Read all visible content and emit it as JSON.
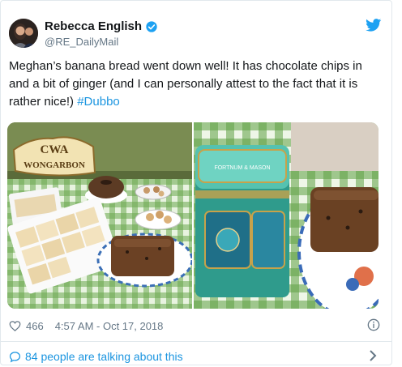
{
  "tweet": {
    "author": {
      "display_name": "Rebecca English",
      "handle": "@RE_DailyMail",
      "verified": true,
      "avatar_icon": "avatar-photo"
    },
    "text_main": "Meghan’s banana bread went down well! It has chocolate chips in and a bit of ginger (and I can personally attest to the fact that it is rather nice!) ",
    "hashtag": "#Dubbo",
    "photos": [
      {
        "sign_line1": "CWA",
        "sign_line2": "WONGARBON"
      },
      {
        "tin_brand": "FORTNUM & MASON"
      }
    ],
    "likes": "466",
    "timestamp": "4:57 AM - Oct 17, 2018",
    "talking": "84 people are talking about this"
  },
  "icons": {
    "platform": "twitter-bird-icon",
    "verified": "verified-badge-icon",
    "like": "heart-icon",
    "info": "info-icon",
    "reply": "speech-bubble-icon",
    "chevron": "chevron-right-icon"
  },
  "colors": {
    "accent": "#1b95e0",
    "muted": "#657786",
    "text": "#14171a"
  }
}
